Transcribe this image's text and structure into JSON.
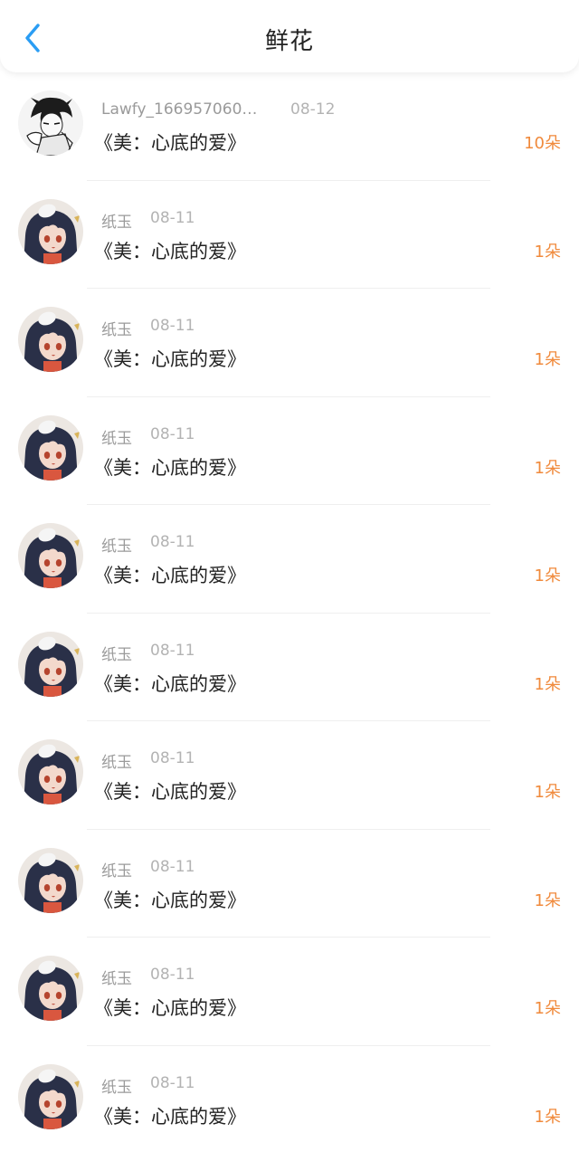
{
  "header": {
    "title": "鲜花",
    "back_icon": "chevron-left-icon"
  },
  "colors": {
    "accent_blue": "#2a9df4",
    "count_orange": "#f08a3c"
  },
  "records": [
    {
      "user": "Lawfy_166957060…",
      "date": "08-12",
      "book": "《美：心底的爱》",
      "count": "10朵",
      "avatar": "monochrome-character-avatar"
    },
    {
      "user": "纸玉",
      "date": "08-11",
      "book": "《美：心底的爱》",
      "count": "1朵",
      "avatar": "anime-character-avatar"
    },
    {
      "user": "纸玉",
      "date": "08-11",
      "book": "《美：心底的爱》",
      "count": "1朵",
      "avatar": "anime-character-avatar"
    },
    {
      "user": "纸玉",
      "date": "08-11",
      "book": "《美：心底的爱》",
      "count": "1朵",
      "avatar": "anime-character-avatar"
    },
    {
      "user": "纸玉",
      "date": "08-11",
      "book": "《美：心底的爱》",
      "count": "1朵",
      "avatar": "anime-character-avatar"
    },
    {
      "user": "纸玉",
      "date": "08-11",
      "book": "《美：心底的爱》",
      "count": "1朵",
      "avatar": "anime-character-avatar"
    },
    {
      "user": "纸玉",
      "date": "08-11",
      "book": "《美：心底的爱》",
      "count": "1朵",
      "avatar": "anime-character-avatar"
    },
    {
      "user": "纸玉",
      "date": "08-11",
      "book": "《美：心底的爱》",
      "count": "1朵",
      "avatar": "anime-character-avatar"
    },
    {
      "user": "纸玉",
      "date": "08-11",
      "book": "《美：心底的爱》",
      "count": "1朵",
      "avatar": "anime-character-avatar"
    },
    {
      "user": "纸玉",
      "date": "08-11",
      "book": "《美：心底的爱》",
      "count": "1朵",
      "avatar": "anime-character-avatar"
    }
  ]
}
